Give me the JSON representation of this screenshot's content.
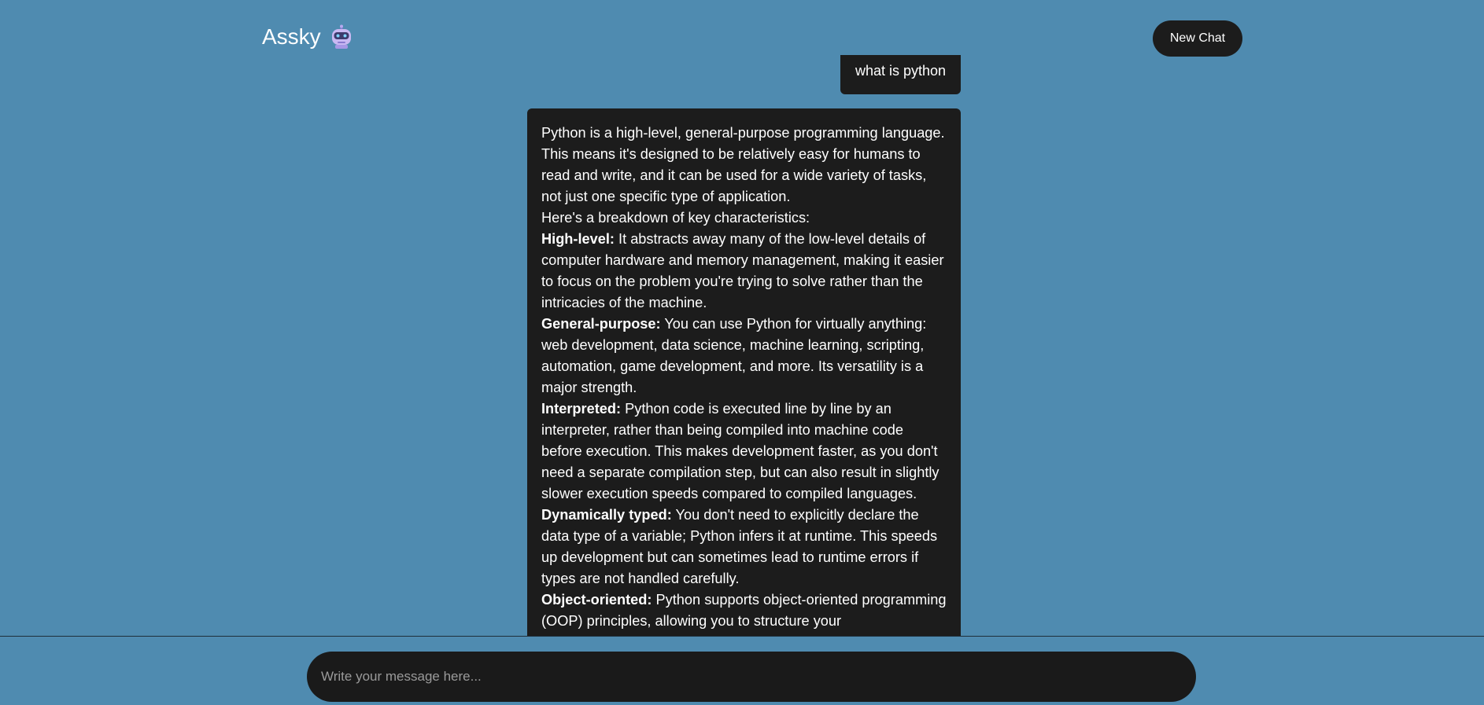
{
  "header": {
    "app_title": "Assky",
    "logo_icon": "robot-icon",
    "new_chat_label": "New Chat"
  },
  "conversation": {
    "user_message": "what is python",
    "assistant_message": {
      "intro": "Python is a high-level, general-purpose programming language. This means it's designed to be relatively easy for humans to read and write, and it can be used for a wide variety of tasks, not just one specific type of application.",
      "breakdown_intro": "Here's a breakdown of key characteristics:",
      "points": [
        {
          "title": "High-level:",
          "text": " It abstracts away many of the low-level details of computer hardware and memory management, making it easier to focus on the problem you're trying to solve rather than the intricacies of the machine."
        },
        {
          "title": "General-purpose:",
          "text": " You can use Python for virtually anything: web development, data science, machine learning, scripting, automation, game development, and more. Its versatility is a major strength."
        },
        {
          "title": "Interpreted:",
          "text": " Python code is executed line by line by an interpreter, rather than being compiled into machine code before execution. This makes development faster, as you don't need a separate compilation step, but can also result in slightly slower execution speeds compared to compiled languages."
        },
        {
          "title": "Dynamically typed:",
          "text": " You don't need to explicitly declare the data type of a variable; Python infers it at runtime. This speeds up development but can sometimes lead to runtime errors if types are not handled carefully."
        },
        {
          "title": "Object-oriented:",
          "text": " Python supports object-oriented programming (OOP) principles, allowing you to structure your"
        }
      ]
    }
  },
  "composer": {
    "placeholder": "Write your message here..."
  },
  "colors": {
    "background": "#4f8bb0",
    "bubble": "#1c1c1c",
    "text": "#ffffff"
  }
}
